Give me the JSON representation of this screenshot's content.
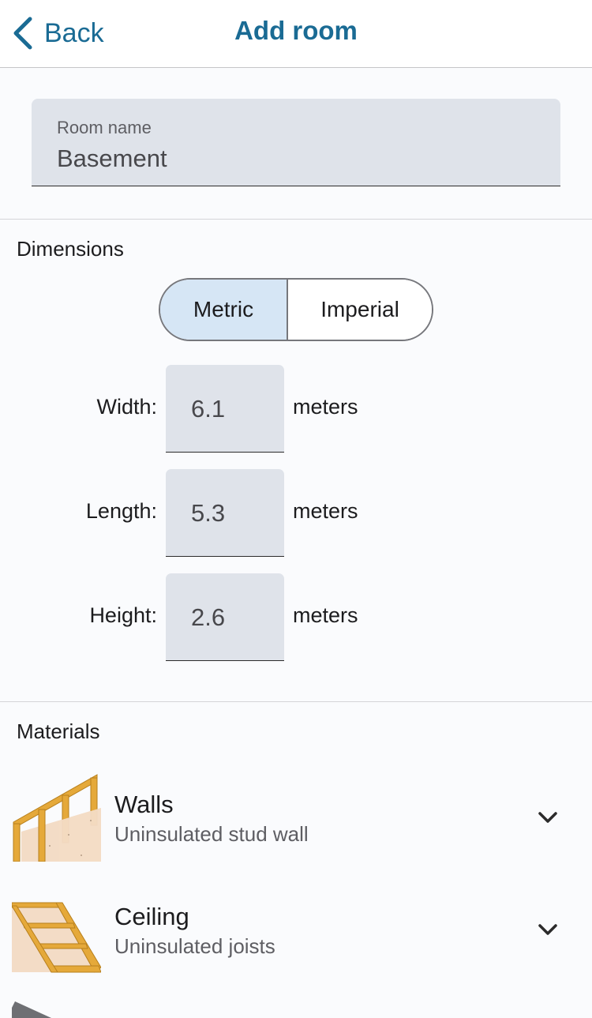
{
  "header": {
    "back_label": "Back",
    "title": "Add room"
  },
  "room_name": {
    "label": "Room name",
    "value": "Basement"
  },
  "dimensions": {
    "section_title": "Dimensions",
    "unit_toggle": {
      "options": [
        "Metric",
        "Imperial"
      ],
      "selected": "Metric"
    },
    "rows": [
      {
        "label": "Width:",
        "value": "6.1",
        "unit": "meters"
      },
      {
        "label": "Length:",
        "value": "5.3",
        "unit": "meters"
      },
      {
        "label": "Height:",
        "value": "2.6",
        "unit": "meters"
      }
    ]
  },
  "materials": {
    "section_title": "Materials",
    "items": [
      {
        "title": "Walls",
        "subtitle": "Uninsulated stud wall",
        "icon": "stud-wall-icon"
      },
      {
        "title": "Ceiling",
        "subtitle": "Uninsulated joists",
        "icon": "ceiling-joists-icon"
      }
    ]
  },
  "colors": {
    "accent": "#1a6b94",
    "field_bg": "#dfe3ea",
    "toggle_selected_bg": "#d6e6f5",
    "wood": "#e5a93a",
    "drywall": "#f3dcc6"
  }
}
